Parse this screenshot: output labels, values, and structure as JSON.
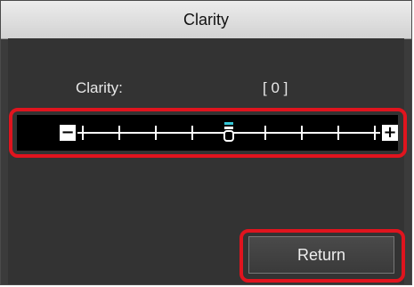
{
  "dialog": {
    "title": "Clarity",
    "setting_label": "Clarity:",
    "setting_value": "[ 0 ]"
  },
  "slider": {
    "min_symbol": "−",
    "max_symbol": "+",
    "min": -4,
    "max": 4,
    "value": 0
  },
  "buttons": {
    "return_label": "Return"
  },
  "colors": {
    "highlight": "#e0141e",
    "thumb_accent": "#35c8d8"
  }
}
